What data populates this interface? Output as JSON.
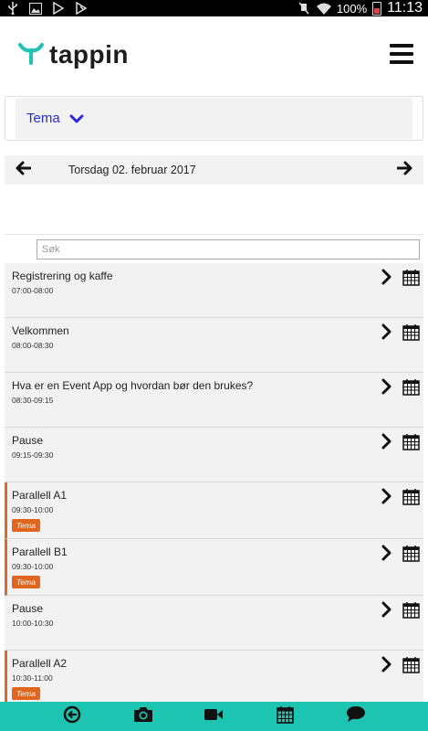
{
  "status_bar": {
    "battery": "100%",
    "time": "11:13",
    "icons": [
      "usb-icon",
      "image-icon",
      "play-store-icon",
      "flag-icon",
      "mute-icon",
      "wifi-icon",
      "battery-icon"
    ]
  },
  "header": {
    "logo_text": "tappin",
    "logo_color": "#1ec4b2",
    "menu_icon": "hamburger-icon"
  },
  "theme_filter": {
    "label": "Tema",
    "icon": "chevron-down-icon",
    "color": "#2a2ad4"
  },
  "date_nav": {
    "date": "Torsdag 02. februar 2017",
    "prev_icon": "arrow-left-icon",
    "next_icon": "arrow-right-icon"
  },
  "search": {
    "placeholder": "Søk",
    "value": ""
  },
  "agenda": [
    {
      "title": "Registrering og kaffe",
      "time": "07:00-08:00",
      "tag": ""
    },
    {
      "title": "Velkommen",
      "time": "08:00-08:30",
      "tag": ""
    },
    {
      "title": "Hva er en Event App og hvordan bør den brukes?",
      "time": "08:30-09:15",
      "tag": ""
    },
    {
      "title": "Pause",
      "time": "09:15-09:30",
      "tag": ""
    },
    {
      "title": "Parallell A1",
      "time": "09:30-10:00",
      "tag": "Tema"
    },
    {
      "title": "Parallell B1",
      "time": "09:30-10:00",
      "tag": "Tema"
    },
    {
      "title": "Pause",
      "time": "10:00-10:30",
      "tag": ""
    },
    {
      "title": "Parallell A2",
      "time": "10:30-11:00",
      "tag": "Tema"
    }
  ],
  "tag_color": "#e0651e",
  "bottom_nav": {
    "color": "#1ec4b2",
    "items": [
      "back-icon",
      "camera-icon",
      "video-icon",
      "calendar-icon",
      "chat-icon"
    ]
  }
}
